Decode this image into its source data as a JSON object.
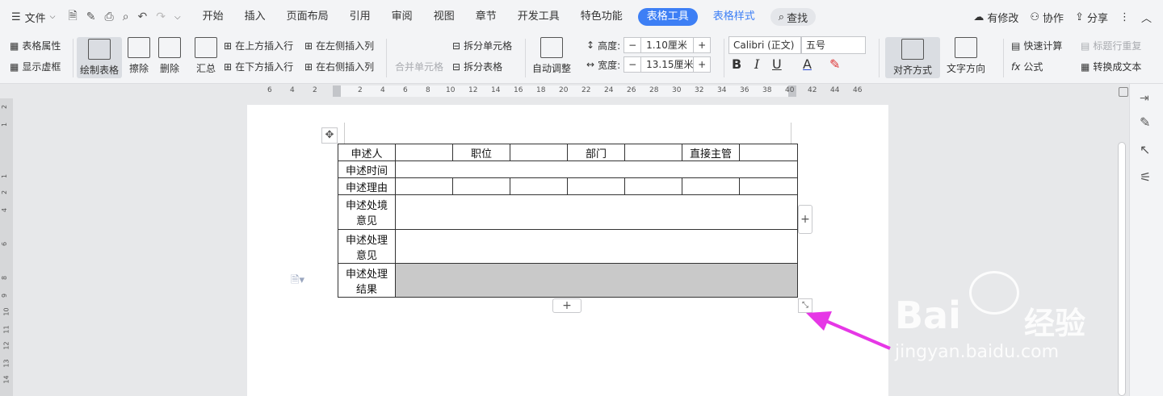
{
  "menubar": {
    "file_label": "文件",
    "tabs": [
      "开始",
      "插入",
      "页面布局",
      "引用",
      "审阅",
      "视图",
      "章节",
      "开发工具",
      "特色功能"
    ],
    "active_tab": "表格工具",
    "style_tab": "表格样式",
    "search_label": "查找",
    "right": {
      "modify": "有修改",
      "collab": "协作",
      "share": "分享"
    }
  },
  "ribbon": {
    "table_props": "表格属性",
    "show_grid": "显示虚框",
    "draw_table": "绘制表格",
    "erase": "擦除",
    "delete": "删除",
    "summary": "汇总",
    "insert_above": "在上方插入行",
    "insert_below": "在下方插入行",
    "insert_left": "在左侧插入列",
    "insert_right": "在右侧插入列",
    "merge_cells": "合并单元格",
    "split_cells": "拆分单元格",
    "split_table": "拆分表格",
    "auto_adjust": "自动调整",
    "height_label": "高度:",
    "height_value": "1.10厘米",
    "width_label": "宽度:",
    "width_value": "13.15厘米",
    "font_name": "Calibri (正文)",
    "font_size": "五号",
    "align": "对齐方式",
    "text_dir": "文字方向",
    "quick_calc": "快速计算",
    "repeat_header": "标题行重复",
    "formula": "公式",
    "to_text": "转换成文本"
  },
  "ruler": {
    "h_ticks": [
      "6",
      "4",
      "2",
      "2",
      "4",
      "6",
      "8",
      "10",
      "12",
      "14",
      "16",
      "18",
      "20",
      "22",
      "24",
      "26",
      "28",
      "30",
      "32",
      "34",
      "36",
      "38",
      "40",
      "42",
      "44",
      "46"
    ],
    "v_ticks": [
      "2",
      "1",
      "1",
      "2",
      "4",
      "6",
      "8",
      "9",
      "10",
      "11",
      "12",
      "13",
      "14"
    ]
  },
  "table": {
    "r1": [
      "申述人",
      "",
      "职位",
      "",
      "部门",
      "",
      "直接主管",
      ""
    ],
    "r2": "申述时间",
    "r3": "申述理由",
    "r4": [
      "申述处境",
      "意见"
    ],
    "r5": [
      "申述处理",
      "意见"
    ],
    "r6": [
      "申述处理",
      "结果"
    ]
  },
  "watermark": {
    "brand": "Bai",
    "brand2": "经验",
    "url": "jingyan.baidu.com"
  },
  "colors": {
    "accent": "#3d7ff5",
    "arrow": "#e637e6",
    "shade": "#c9c9c9"
  }
}
